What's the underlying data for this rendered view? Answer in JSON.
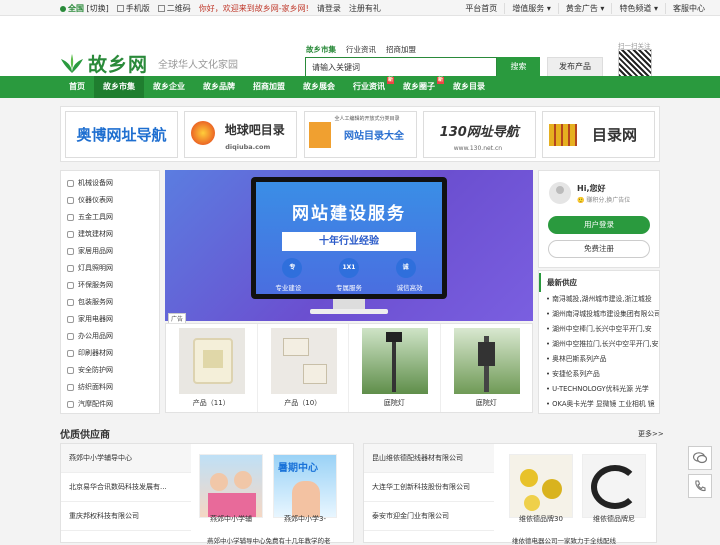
{
  "topbar": {
    "region": "全国",
    "switch": "[切换]",
    "mobile": "手机版",
    "qrcode": "二维码",
    "welcome": "你好，欢迎来到故乡网-家乡网!",
    "login": "请登录",
    "register": "注册有礼",
    "links": [
      "平台首页",
      "增值服务 ▾",
      "黄金广告 ▾",
      "特色频道 ▾",
      "客服中心"
    ]
  },
  "header": {
    "logo": "故乡网",
    "slogan": "全球华人文化家园",
    "search_tabs": [
      "故乡市集",
      "行业资讯",
      "招商加盟"
    ],
    "search_placeholder": "请输入关键词",
    "search_button": "搜索",
    "publish_button": "发布产品",
    "qr_label": "扫一扫关注"
  },
  "nav": [
    {
      "label": "首页",
      "active": false,
      "badge": ""
    },
    {
      "label": "故乡市集",
      "active": true,
      "badge": ""
    },
    {
      "label": "故乡企业",
      "active": false,
      "badge": ""
    },
    {
      "label": "故乡品牌",
      "active": false,
      "badge": ""
    },
    {
      "label": "招商加盟",
      "active": false,
      "badge": ""
    },
    {
      "label": "故乡展会",
      "active": false,
      "badge": ""
    },
    {
      "label": "行业资讯",
      "active": false,
      "badge": "新"
    },
    {
      "label": "故乡圈子",
      "active": false,
      "badge": "新"
    },
    {
      "label": "故乡目录",
      "active": false,
      "badge": ""
    }
  ],
  "banners": [
    {
      "text": "奥博网址导航",
      "color": "#1f6fd0"
    },
    {
      "text": "地球吧目录",
      "sub": "diqiuba.com",
      "color": "#222"
    },
    {
      "text": "网站目录大全",
      "sub": "全人工编辑的开放式分类目录",
      "color": "#2a6fd0"
    },
    {
      "text": "130网址导航",
      "sub": "www.130.net.cn",
      "color": "#222"
    },
    {
      "text": "目录网",
      "color": "#222"
    }
  ],
  "categories": [
    "机械设备网",
    "仪器仪表网",
    "五金工具网",
    "建筑建材网",
    "家居用品网",
    "灯具照明网",
    "环保服务网",
    "包装服务网",
    "家用电器网",
    "办公用品网",
    "印刷器材网",
    "安全防护网",
    "纺织面料网",
    "汽摩配件网"
  ],
  "hero": {
    "title": "网站建设服务",
    "bar": "十年行业经验",
    "circles": [
      "专",
      "1X1",
      "诚"
    ],
    "labels": [
      "专业建设",
      "专属服务",
      "诚信高效"
    ],
    "ad_tag": "广告"
  },
  "products": [
    {
      "name": "产品（11）"
    },
    {
      "name": "产品（10）"
    },
    {
      "name": "庭院灯"
    },
    {
      "name": "庭院灯"
    }
  ],
  "user": {
    "greeting": "Hi,您好",
    "level": "🙂 赚积分,换广告位",
    "login_button": "用户登录",
    "register_button": "免费注册"
  },
  "latest": {
    "title": "最新供应",
    "items": [
      "南浔城投,湖州城市建设,浙江城投",
      "湖州南浔城投城市建设集团有限公司",
      "湖州中空棒门,长兴中空平开门,安",
      "湖州中空推拉门,长兴中空平开门,安吉",
      "奥林巴斯系列产品",
      "安捷伦系列产品",
      "U-TECHNOLOGY优科光源 光学",
      "OKA奥卡光学 显微镜 工业相机 镜"
    ]
  },
  "suppliers": {
    "title": "优质供应商",
    "more": "更多>>",
    "left": {
      "list": [
        "燕郊中小学辅导中心",
        "北京易华合讯数码科技发展有...",
        "重庆邦权科技有限公司"
      ],
      "thumbs": [
        {
          "caption": "燕郊中小学辅"
        },
        {
          "caption": "燕郊中小学3-",
          "badge": "暑期中心"
        }
      ],
      "sub": "燕郊中小学辅导中心免费有十几年教学的老"
    },
    "right": {
      "list": [
        "昆山维依德配线器材有限公司",
        "大连华工创新科技股份有限公司",
        "泰安市迎金门业有限公司"
      ],
      "thumbs": [
        {
          "caption": "维依德品牌30"
        },
        {
          "caption": "维依德品牌尼"
        }
      ],
      "sub": "维依德电器公司一家致力于全线配线"
    }
  },
  "side_icons": [
    "chat-icon",
    "phone-icon"
  ],
  "colors": {
    "green": "#2a9a3e",
    "dark_green": "#1f7e2f"
  }
}
